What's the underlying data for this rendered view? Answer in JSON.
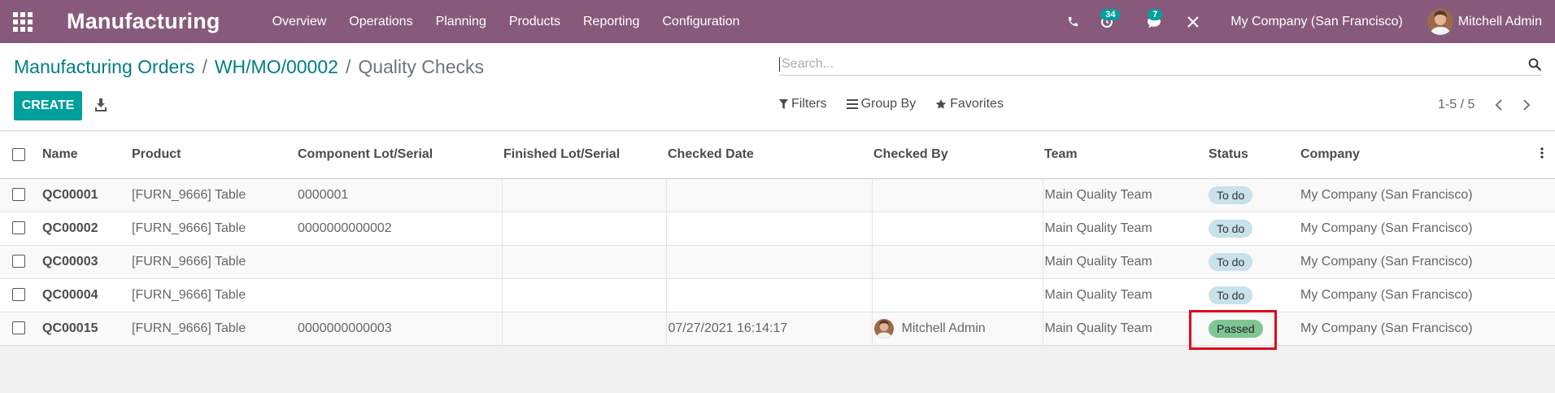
{
  "navbar": {
    "app_title": "Manufacturing",
    "menu": [
      "Overview",
      "Operations",
      "Planning",
      "Products",
      "Reporting",
      "Configuration"
    ],
    "activity_badge": "34",
    "messages_badge": "7",
    "company": "My Company (San Francisco)",
    "user": "Mitchell Admin",
    "color": "#875a7b"
  },
  "breadcrumb": {
    "items": [
      "Manufacturing Orders",
      "WH/MO/00002"
    ],
    "separator": "/",
    "active": "Quality Checks"
  },
  "search": {
    "placeholder": "Search..."
  },
  "actions": {
    "create": "CREATE"
  },
  "filters": {
    "filters": "Filters",
    "group_by": "Group By",
    "favorites": "Favorites"
  },
  "pager": {
    "value": "1-5 / 5"
  },
  "table": {
    "headers": {
      "name": "Name",
      "product": "Product",
      "component_lot": "Component Lot/Serial",
      "finished_lot": "Finished Lot/Serial",
      "checked_date": "Checked Date",
      "checked_by": "Checked By",
      "team": "Team",
      "status": "Status",
      "company": "Company"
    },
    "rows": [
      {
        "name": "QC00001",
        "product": "[FURN_9666] Table",
        "component_lot": "0000001",
        "finished_lot": "",
        "checked_date": "",
        "checked_by": "",
        "team": "Main Quality Team",
        "status": "To do",
        "company": "My Company (San Francisco)"
      },
      {
        "name": "QC00002",
        "product": "[FURN_9666] Table",
        "component_lot": "0000000000002",
        "finished_lot": "",
        "checked_date": "",
        "checked_by": "",
        "team": "Main Quality Team",
        "status": "To do",
        "company": "My Company (San Francisco)"
      },
      {
        "name": "QC00003",
        "product": "[FURN_9666] Table",
        "component_lot": "",
        "finished_lot": "",
        "checked_date": "",
        "checked_by": "",
        "team": "Main Quality Team",
        "status": "To do",
        "company": "My Company (San Francisco)"
      },
      {
        "name": "QC00004",
        "product": "[FURN_9666] Table",
        "component_lot": "",
        "finished_lot": "",
        "checked_date": "",
        "checked_by": "",
        "team": "Main Quality Team",
        "status": "To do",
        "company": "My Company (San Francisco)"
      },
      {
        "name": "QC00015",
        "product": "[FURN_9666] Table",
        "component_lot": "0000000000003",
        "finished_lot": "",
        "checked_date": "07/27/2021 16:14:17",
        "checked_by": "Mitchell Admin",
        "team": "Main Quality Team",
        "status": "Passed",
        "company": "My Company (San Francisco)"
      }
    ]
  },
  "colors": {
    "accent": "#00a09d",
    "link": "#017e84",
    "highlight": "#e0081c",
    "todo": "#c8e1ea",
    "passed": "#7ec594"
  }
}
